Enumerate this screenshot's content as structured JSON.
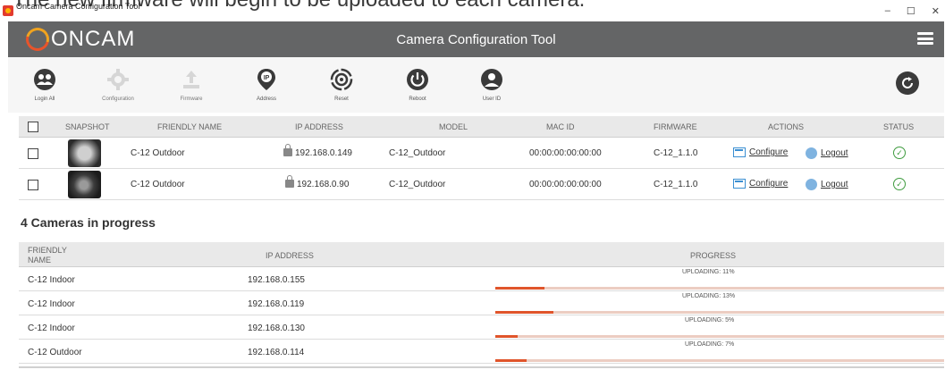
{
  "caption": "The new firmware will begin to be uploaded to each camera.",
  "window": {
    "title": "Oncam Camera Configuration Tool",
    "controls": [
      "–",
      "☐",
      "✕"
    ]
  },
  "header": {
    "logo_text": "ONCAM",
    "title": "Camera Configuration Tool"
  },
  "toolbar": {
    "items": [
      {
        "label": "Login All",
        "icon": "login-all-icon",
        "enabled": true
      },
      {
        "label": "Configuration",
        "icon": "configuration-gear-icon",
        "enabled": false
      },
      {
        "label": "Firmware",
        "icon": "firmware-upload-icon",
        "enabled": false
      },
      {
        "label": "Address",
        "icon": "ip-address-icon",
        "enabled": true
      },
      {
        "label": "Reset",
        "icon": "reset-icon",
        "enabled": true
      },
      {
        "label": "Reboot",
        "icon": "reboot-power-icon",
        "enabled": true
      },
      {
        "label": "User ID",
        "icon": "user-id-icon",
        "enabled": true
      }
    ],
    "refresh_icon": "refresh-icon"
  },
  "camera_table": {
    "headers": {
      "snapshot": "SNAPSHOT",
      "friendly_name": "FRIENDLY NAME",
      "ip_address": "IP ADDRESS",
      "model": "MODEL",
      "mac_id": "MAC ID",
      "firmware": "FIRMWARE",
      "actions": "ACTIONS",
      "status": "STATUS"
    },
    "rows": [
      {
        "friendly_name": "C-12 Outdoor",
        "ip_address": "192.168.0.149",
        "model": "C-12_Outdoor",
        "mac_id": "00:00:00:00:00:00",
        "firmware": "C-12_1.1.0",
        "configure": "Configure",
        "logout": "Logout"
      },
      {
        "friendly_name": "C-12 Outdoor",
        "ip_address": "192.168.0.90",
        "model": "C-12_Outdoor",
        "mac_id": "00:00:00:00:00:00",
        "firmware": "C-12_1.1.0",
        "configure": "Configure",
        "logout": "Logout"
      }
    ]
  },
  "progress_section": {
    "title": "4 Cameras in progress",
    "headers": {
      "friendly_name_line1": "FRIENDLY",
      "friendly_name_line2": "NAME",
      "ip_address": "IP ADDRESS",
      "progress": "PROGRESS"
    },
    "rows": [
      {
        "friendly_name": "C-12 Indoor",
        "ip_address": "192.168.0.155",
        "status_text": "UPLOADING: 11%",
        "percent": 11
      },
      {
        "friendly_name": "C-12 Indoor",
        "ip_address": "192.168.0.119",
        "status_text": "UPLOADING: 13%",
        "percent": 13
      },
      {
        "friendly_name": "C-12 Indoor",
        "ip_address": "192.168.0.130",
        "status_text": "UPLOADING: 5%",
        "percent": 5
      },
      {
        "friendly_name": "C-12 Outdoor",
        "ip_address": "192.168.0.114",
        "status_text": "UPLOADING: 7%",
        "percent": 7
      }
    ]
  },
  "colors": {
    "header_bg": "#646566",
    "accent_orange": "#e0552b",
    "progress_track": "#eccdc2",
    "status_ok": "#3e9b3e",
    "link_blue": "#3b8fd2"
  }
}
